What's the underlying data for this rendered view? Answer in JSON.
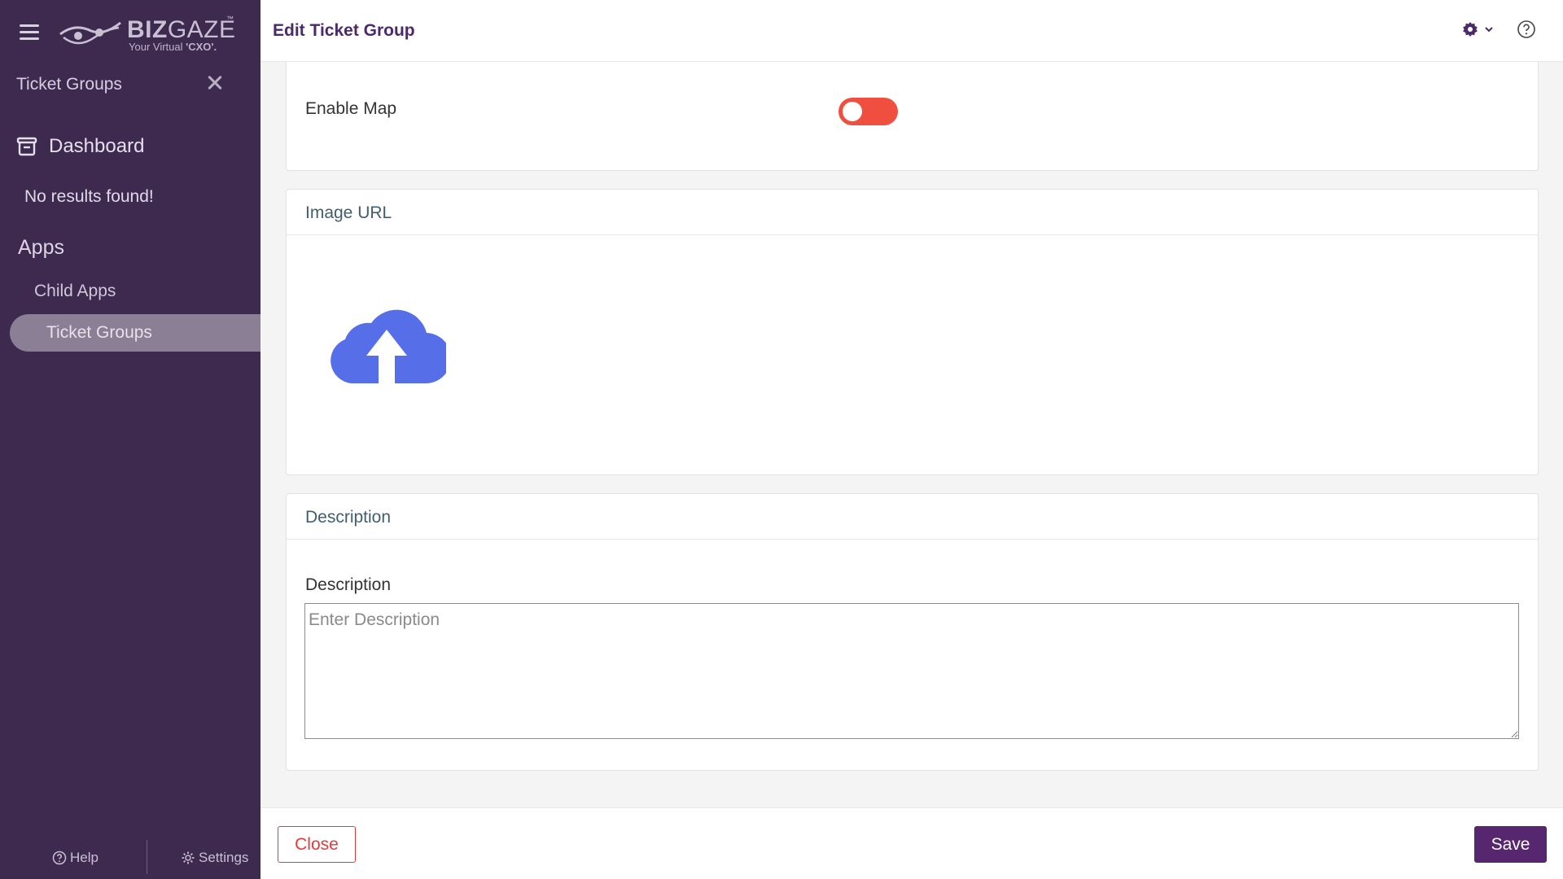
{
  "sidebar": {
    "logo": {
      "brand_bold": "BIZ",
      "brand_light": "GAZE",
      "trademark": "™",
      "tagline_prefix": "Your Virtual ",
      "tagline_bold": "'CXO'."
    },
    "title": "Ticket Groups",
    "dashboard_label": "Dashboard",
    "no_results": "No results found!",
    "apps_heading": "Apps",
    "items": [
      {
        "label": "Child Apps",
        "active": false
      },
      {
        "label": "Ticket Groups",
        "active": true
      }
    ],
    "footer": {
      "help_label": "Help",
      "settings_label": "Settings"
    }
  },
  "header": {
    "title": "Edit Ticket Group"
  },
  "form": {
    "enable_map": {
      "label": "Enable Map",
      "on": false
    },
    "image_section": {
      "title": "Image URL"
    },
    "description_section": {
      "title": "Description",
      "field_label": "Description",
      "value": "",
      "placeholder": "Enter Description"
    }
  },
  "footer": {
    "close_label": "Close",
    "save_label": "Save"
  },
  "colors": {
    "sidebar_bg": "#3f2a4f",
    "accent": "#56266f",
    "toggle_off": "#f04e3e",
    "upload_icon": "#566ee8",
    "close": "#e33b3b"
  },
  "icons": [
    "hamburger-icon",
    "logo-eye-icon",
    "close-icon",
    "dashboard-icon",
    "help-circle-icon",
    "gear-icon",
    "chevron-down-icon",
    "cloud-upload-icon"
  ]
}
